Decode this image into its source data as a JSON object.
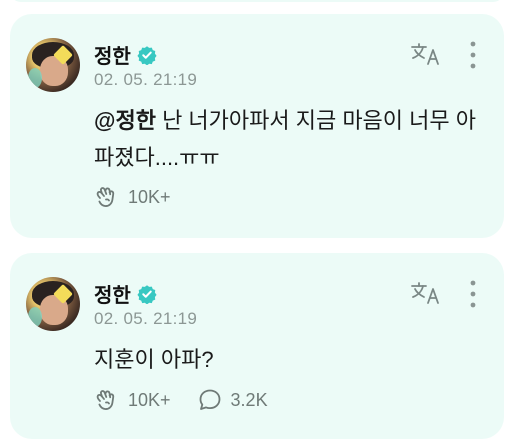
{
  "posts": [
    {
      "author": "정한",
      "timestamp": "02. 05. 21:19",
      "mention": "@정한",
      "text": "난 너가아파서 지금 마음이 너무 아파졌다....ㅠㅠ",
      "likes": "10K+",
      "comments": null
    },
    {
      "author": "정한",
      "timestamp": "02. 05. 21:19",
      "mention": "",
      "text": "지훈이 아파?",
      "likes": "10K+",
      "comments": "3.2K"
    }
  ],
  "colors": {
    "card_bg": "#ecfbf7",
    "verified": "#38c8c2",
    "muted": "#8c9794"
  },
  "icons": {
    "verified": "verified-badge-icon",
    "translate": "translate-icon",
    "more": "more-vertical-icon",
    "like": "like-hand-icon",
    "comment": "comment-bubble-icon"
  }
}
